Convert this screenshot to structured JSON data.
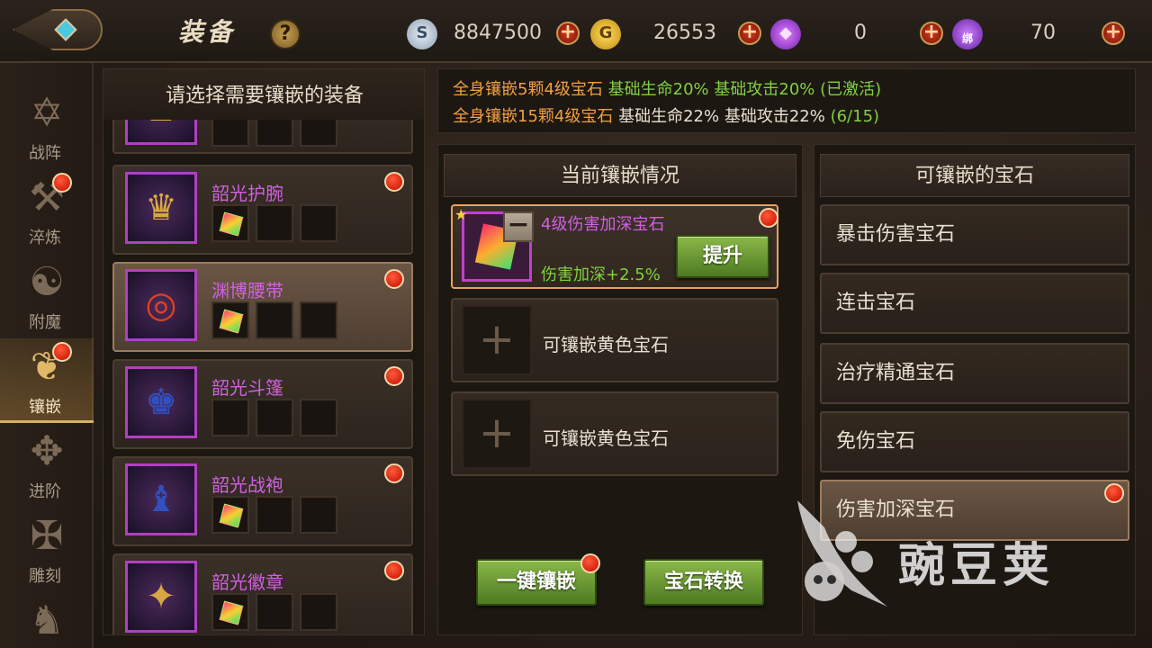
{
  "header": {
    "title": "装备",
    "help_label": "?",
    "currencies": [
      {
        "icon": "silver-coin-icon",
        "value": "8847500",
        "symbol": "S"
      },
      {
        "icon": "gold-coin-icon",
        "value": "26553",
        "symbol": "G"
      },
      {
        "icon": "purple-crystal-icon",
        "value": "0",
        "symbol": "◆"
      },
      {
        "icon": "bound-crystal-icon",
        "value": "70",
        "symbol": "绑"
      }
    ],
    "plus_label": "+"
  },
  "sidenav": [
    {
      "label": "战阵",
      "icon": "hexagram-icon",
      "glyph": "✡",
      "badge": false
    },
    {
      "label": "淬炼",
      "icon": "forge-icon",
      "glyph": "⚒",
      "badge": true
    },
    {
      "label": "附魔",
      "icon": "enchant-icon",
      "glyph": "☯",
      "badge": false
    },
    {
      "label": "镶嵌",
      "icon": "inlay-icon",
      "glyph": "❦",
      "badge": true,
      "active": true
    },
    {
      "label": "进阶",
      "icon": "advance-icon",
      "glyph": "✥",
      "badge": false
    },
    {
      "label": "雕刻",
      "icon": "carve-icon",
      "glyph": "✠",
      "badge": false
    },
    {
      "label": "",
      "icon": "beast-icon",
      "glyph": "♞",
      "badge": false
    }
  ],
  "equipment": {
    "header": "请选择需要镶嵌的装备",
    "items": [
      {
        "name": "",
        "icon": "partial-item-icon",
        "glyph": "♜",
        "gem": false
      },
      {
        "name": "韶光护腕",
        "icon": "bracer-icon",
        "glyph": "♛",
        "gem": true,
        "badge": true
      },
      {
        "name": "渊博腰带",
        "icon": "belt-icon",
        "glyph": "◎",
        "gem": true,
        "badge": true,
        "selected": true
      },
      {
        "name": "韶光斗篷",
        "icon": "cloak-icon",
        "glyph": "♚",
        "gem": false,
        "badge": true
      },
      {
        "name": "韶光战袍",
        "icon": "robe-icon",
        "glyph": "♝",
        "gem": true,
        "badge": true
      },
      {
        "name": "韶光徽章",
        "icon": "badge-emblem-icon",
        "glyph": "✦",
        "gem": true,
        "badge": true
      }
    ]
  },
  "bonus": {
    "line1": {
      "req": "全身镶嵌5颗4级宝石",
      "effect": "基础生命20% 基础攻击20%",
      "status": "(已激活)"
    },
    "line2": {
      "req": "全身镶嵌15颗4级宝石",
      "effect": "基础生命22% 基础攻击22%",
      "status": "(6/15)"
    }
  },
  "current": {
    "header": "当前镶嵌情况",
    "filled": {
      "name": "4级伤害加深宝石",
      "effect": "伤害加深+2.5%",
      "upgrade_label": "提升",
      "minus": "−"
    },
    "empty_slots": [
      "可镶嵌黄色宝石",
      "可镶嵌黄色宝石"
    ],
    "plus_glyph": "+",
    "one_click_label": "一键镶嵌",
    "convert_label": "宝石转换"
  },
  "available": {
    "header": "可镶嵌的宝石",
    "gems": [
      "暴击伤害宝石",
      "连击宝石",
      "治疗精通宝石",
      "免伤宝石",
      "伤害加深宝石"
    ]
  },
  "watermark": {
    "text": "豌豆荚"
  },
  "colors": {
    "accent_gold": "#d8b060",
    "badge_red": "#c40c00",
    "gem_purple": "#d060e0",
    "effect_green": "#80d040",
    "bonus_orange": "#f0a040"
  }
}
